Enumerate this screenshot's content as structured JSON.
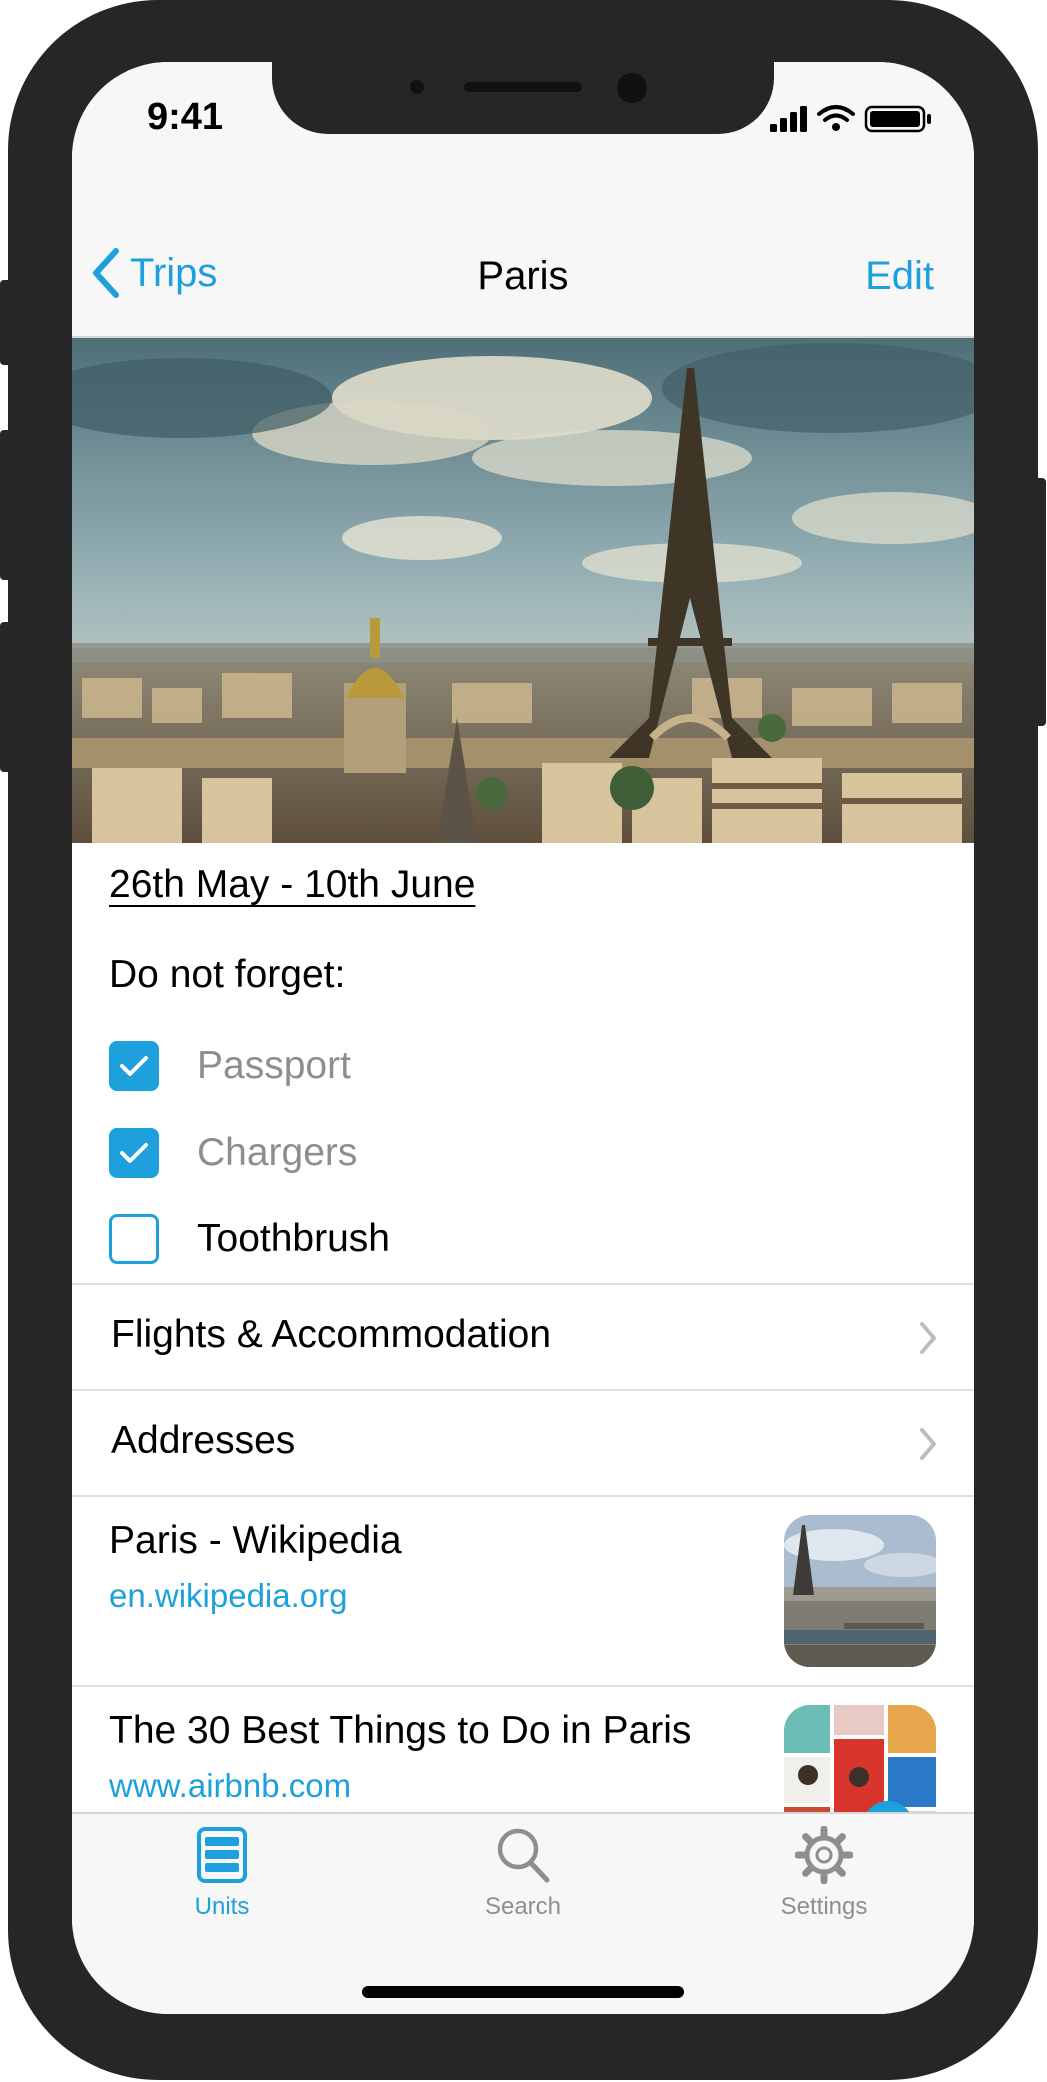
{
  "status_bar": {
    "time": "9:41"
  },
  "nav": {
    "back_label": "Trips",
    "title": "Paris",
    "edit_label": "Edit"
  },
  "hero": {
    "alt": "Paris skyline with the Eiffel Tower"
  },
  "trip": {
    "dates": "26th May - 10th June"
  },
  "checklist": {
    "heading": "Do not forget:",
    "items": [
      {
        "label": "Passport",
        "checked": true
      },
      {
        "label": "Chargers",
        "checked": true
      },
      {
        "label": "Toothbrush",
        "checked": false
      }
    ]
  },
  "sections": [
    {
      "label": "Flights & Accommodation"
    },
    {
      "label": "Addresses"
    }
  ],
  "links": [
    {
      "title": "Paris - Wikipedia",
      "url": "en.wikipedia.org"
    },
    {
      "title": "The 30 Best Things to Do in Paris",
      "url": "www.airbnb.com"
    }
  ],
  "tabs": [
    {
      "label": "Units",
      "icon": "units-icon",
      "active": true
    },
    {
      "label": "Search",
      "icon": "search-icon",
      "active": false
    },
    {
      "label": "Settings",
      "icon": "gear-icon",
      "active": false
    }
  ],
  "colors": {
    "accent": "#1ea0dc",
    "inactive": "#8e8e8e",
    "frame": "#262626"
  }
}
